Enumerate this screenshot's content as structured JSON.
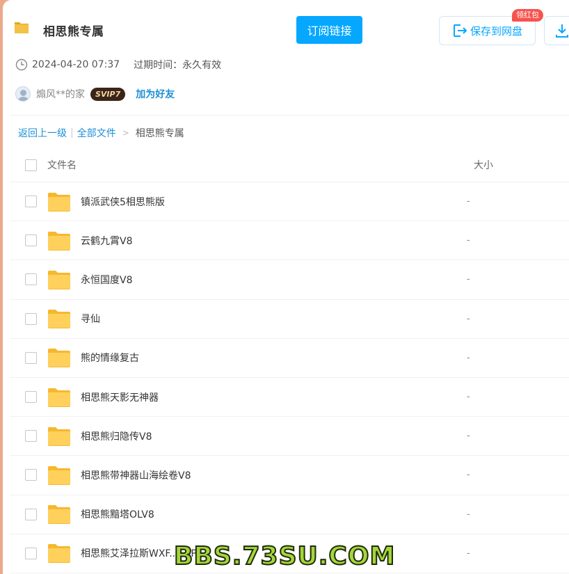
{
  "header": {
    "title": "相思熊专属",
    "subscribe_label": "订阅链接",
    "save_label": "保存到网盘",
    "badge_label": "领红包"
  },
  "meta": {
    "date": "2024-04-20 07:37",
    "expire": "过期时间：永久有效"
  },
  "user": {
    "name": "煽风**的家",
    "vip": "SVIP7",
    "add_friend": "加为好友"
  },
  "breadcrumb": {
    "back": "返回上一级",
    "sep": "|",
    "all_files": "全部文件",
    "arrow": ">",
    "current": "相思熊专属"
  },
  "table": {
    "col_name": "文件名",
    "col_size": "大小",
    "rows": [
      {
        "name": "镇派武侠5相思熊版",
        "size": "-"
      },
      {
        "name": "云鹤九霄V8",
        "size": "-"
      },
      {
        "name": "永恒国度V8",
        "size": "-"
      },
      {
        "name": "寻仙",
        "size": "-"
      },
      {
        "name": "熊的情缘复古",
        "size": "-"
      },
      {
        "name": "相思熊天影无神器",
        "size": "-"
      },
      {
        "name": "相思熊归隐传V8",
        "size": "-"
      },
      {
        "name": "相思熊带神器山海绘卷V8",
        "size": "-"
      },
      {
        "name": "相思熊黯塔OLV8",
        "size": "-"
      },
      {
        "name": "相思熊艾泽拉斯WXF...ESP",
        "size": "-"
      }
    ]
  },
  "watermark": "BBS.73SU.COM",
  "colors": {
    "accent": "#06a7ff",
    "link": "#1c8fd6",
    "folder": "#ffd15c",
    "badge": "#f7534d"
  },
  "icons": {
    "folder": "folder-icon",
    "clock": "clock-icon",
    "save": "save-to-disk-icon",
    "download": "download-icon"
  }
}
